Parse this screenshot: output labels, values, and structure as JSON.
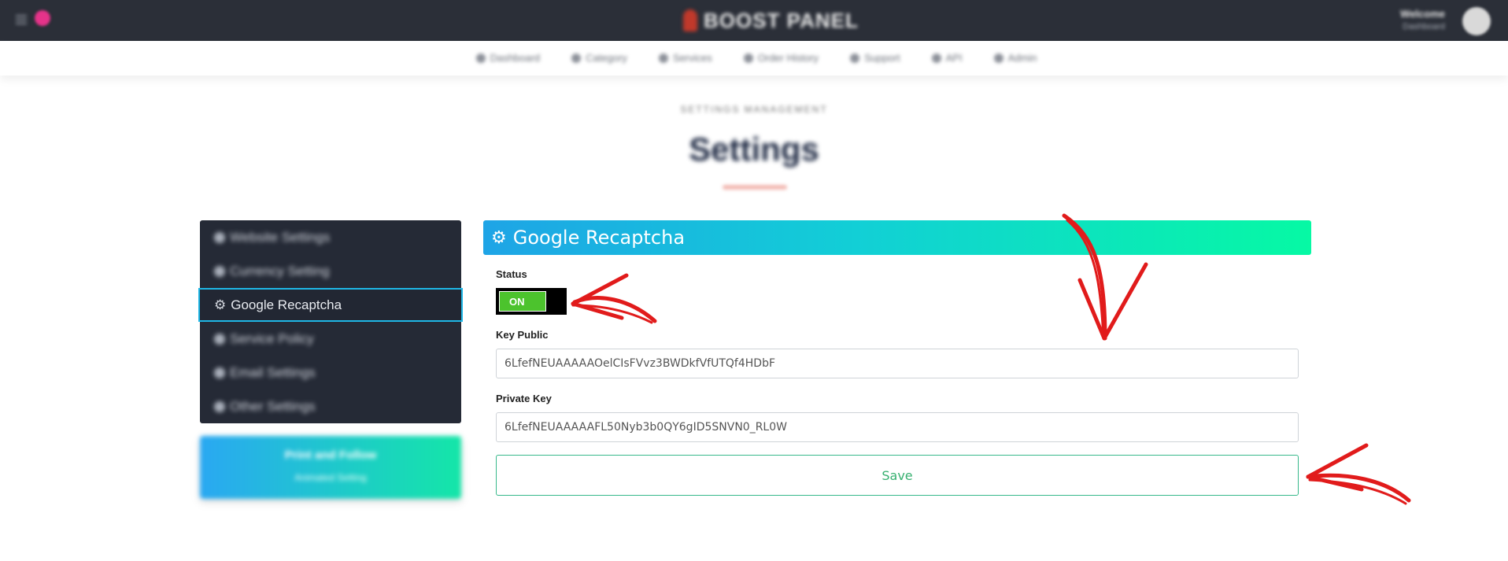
{
  "topbar": {
    "logo_text": "BOOST PANEL",
    "user_name": "Welcome",
    "user_sub": "Dashboard",
    "icons": {
      "menu": "hamburger-icon",
      "notification": "notification-icon",
      "avatar": "user-avatar"
    }
  },
  "nav": {
    "items": [
      {
        "label": "Dashboard",
        "icon": "dashboard-icon"
      },
      {
        "label": "Category",
        "icon": "category-icon"
      },
      {
        "label": "Services",
        "icon": "services-icon"
      },
      {
        "label": "Order History",
        "icon": "orders-icon"
      },
      {
        "label": "Support",
        "icon": "support-icon"
      },
      {
        "label": "API",
        "icon": "api-icon"
      },
      {
        "label": "Admin",
        "icon": "admin-icon"
      }
    ]
  },
  "page": {
    "breadcrumb": "SETTINGS MANAGEMENT",
    "title": "Settings"
  },
  "sidebar": {
    "items": [
      {
        "label": "Website Settings",
        "icon": "gear-icon"
      },
      {
        "label": "Currency Setting",
        "icon": "currency-icon"
      },
      {
        "label": "Google Recaptcha",
        "icon": "gear-icon"
      },
      {
        "label": "Service Policy",
        "icon": "policy-icon"
      },
      {
        "label": "Email Settings",
        "icon": "email-icon"
      },
      {
        "label": "Other Settings",
        "icon": "settings-icon"
      }
    ],
    "active_index": 2,
    "promo_title": "Print and Follow",
    "promo_sub": "Animated Setting"
  },
  "main": {
    "section_title": "Google Recaptcha",
    "status_label": "Status",
    "status_value": "ON",
    "key_public_label": "Key Public",
    "key_public_value": "6LfefNEUAAAAAOelCIsFVvz3BWDkfVfUTQf4HDbF",
    "private_key_label": "Private Key",
    "private_key_value": "6LfefNEUAAAAAFL50Nyb3b0QY6gID5SNVN0_RL0W",
    "save_label": "Save"
  },
  "colors": {
    "topbar_bg": "#2b2f38",
    "sidebar_bg": "#252a36",
    "active_border": "#1fb7e6",
    "gradient_start": "#1ea4e6",
    "gradient_end": "#06f9a4",
    "toggle_on": "#4cc32d",
    "save_border": "#37b88a",
    "annotation_arrow": "#e11b1b"
  }
}
